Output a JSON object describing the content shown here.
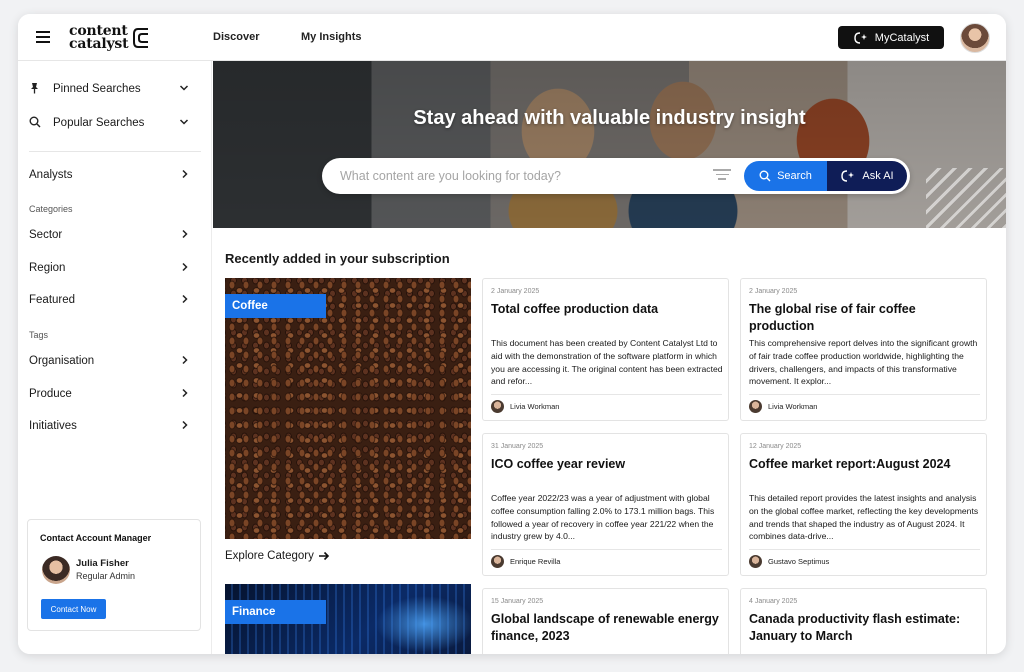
{
  "header": {
    "logo_line1": "content",
    "logo_line2": "catalyst",
    "nav": [
      "Discover",
      "My Insights"
    ],
    "mycatalyst_label": "MyCatalyst"
  },
  "sidebar": {
    "pinned_label": "Pinned Searches",
    "popular_label": "Popular Searches",
    "analysts_label": "Analysts",
    "categories_heading": "Categories",
    "categories": [
      "Sector",
      "Region",
      "Featured"
    ],
    "tags_heading": "Tags",
    "tags": [
      "Organisation",
      "Produce",
      "Initiatives"
    ],
    "contact": {
      "title": "Contact Account Manager",
      "name": "Julia Fisher",
      "role": "Regular Admin",
      "button": "Contact Now"
    }
  },
  "hero": {
    "title": "Stay ahead with valuable industry insight",
    "search_placeholder": "What content are you looking for today?",
    "search_label": "Search",
    "askai_label": "Ask AI"
  },
  "main": {
    "section_title": "Recently added in your subscription",
    "category_tags": [
      "Coffee",
      "Finance"
    ],
    "explore_label": "Explore Category",
    "cards": [
      {
        "date": "2 January 2025",
        "title": "Total coffee production data",
        "desc": "This document has been created by Content Catalyst Ltd to aid with the demonstration of the software platform in which you are accessing it. The original content has been extracted and refor...",
        "author": "Livia Workman"
      },
      {
        "date": "2 January 2025",
        "title": "The global rise of fair coffee production",
        "desc": "This comprehensive report delves into the significant growth of fair trade coffee production worldwide, highlighting the drivers, challengers, and impacts of this transformative movement. It explor...",
        "author": "Livia Workman"
      },
      {
        "date": "31 January 2025",
        "title": "ICO coffee year review",
        "desc": "Coffee year 2022/23 was a year of adjustment with global coffee consumption falling 2.0% to 173.1 million bags. This followed a year of recovery in coffee year 221/22 when the industry grew by 4.0...",
        "author": "Enrique Revilla"
      },
      {
        "date": "12 January 2025",
        "title": "Coffee market report:August 2024",
        "desc": "This detailed report provides the latest insights and analysis on the global coffee market, reflecting the key developments and trends that shaped the industry as of August 2024. It combines data-drive...",
        "author": "Gustavo Septimus"
      },
      {
        "date": "15 January 2025",
        "title": "Global landscape of renewable energy finance, 2023",
        "desc": "",
        "author": ""
      },
      {
        "date": "4 January 2025",
        "title": "Canada productivity flash estimate: January to March",
        "desc": "",
        "author": ""
      }
    ]
  }
}
